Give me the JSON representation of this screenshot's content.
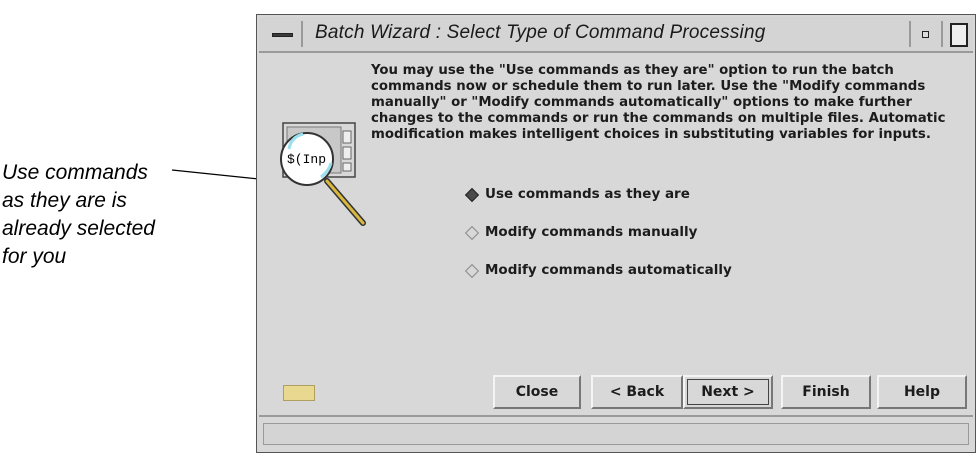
{
  "callout": {
    "lines": [
      "Use commands",
      "as they are is",
      "already selected",
      "for you"
    ]
  },
  "window": {
    "title": "Batch Wizard : Select Type of Command Processing"
  },
  "description": "You may use the \"Use commands as they are\" option to run the batch commands now or schedule them to run later. Use the \"Modify commands manually\" or \"Modify commands automatically\" options to make further changes to the commands or run the commands on multiple files. Automatic modification makes intelligent choices in substituting  variables for inputs.",
  "illustration": {
    "label": "$(Inp"
  },
  "options": [
    {
      "label": "Use commands as they are",
      "selected": true
    },
    {
      "label": "Modify commands manually",
      "selected": false
    },
    {
      "label": "Modify commands automatically",
      "selected": false
    }
  ],
  "buttons": {
    "close": "Close",
    "back": "< Back",
    "next": "Next >",
    "finish": "Finish",
    "help": "Help"
  },
  "icons": {
    "window_menu": "window-menu-icon",
    "minimize": "minimize-icon",
    "maximize": "maximize-icon",
    "magnifier": "magnifying-glass-icon"
  },
  "colors": {
    "window_bg": "#d8d8d8",
    "indicator": "#e8d890"
  }
}
